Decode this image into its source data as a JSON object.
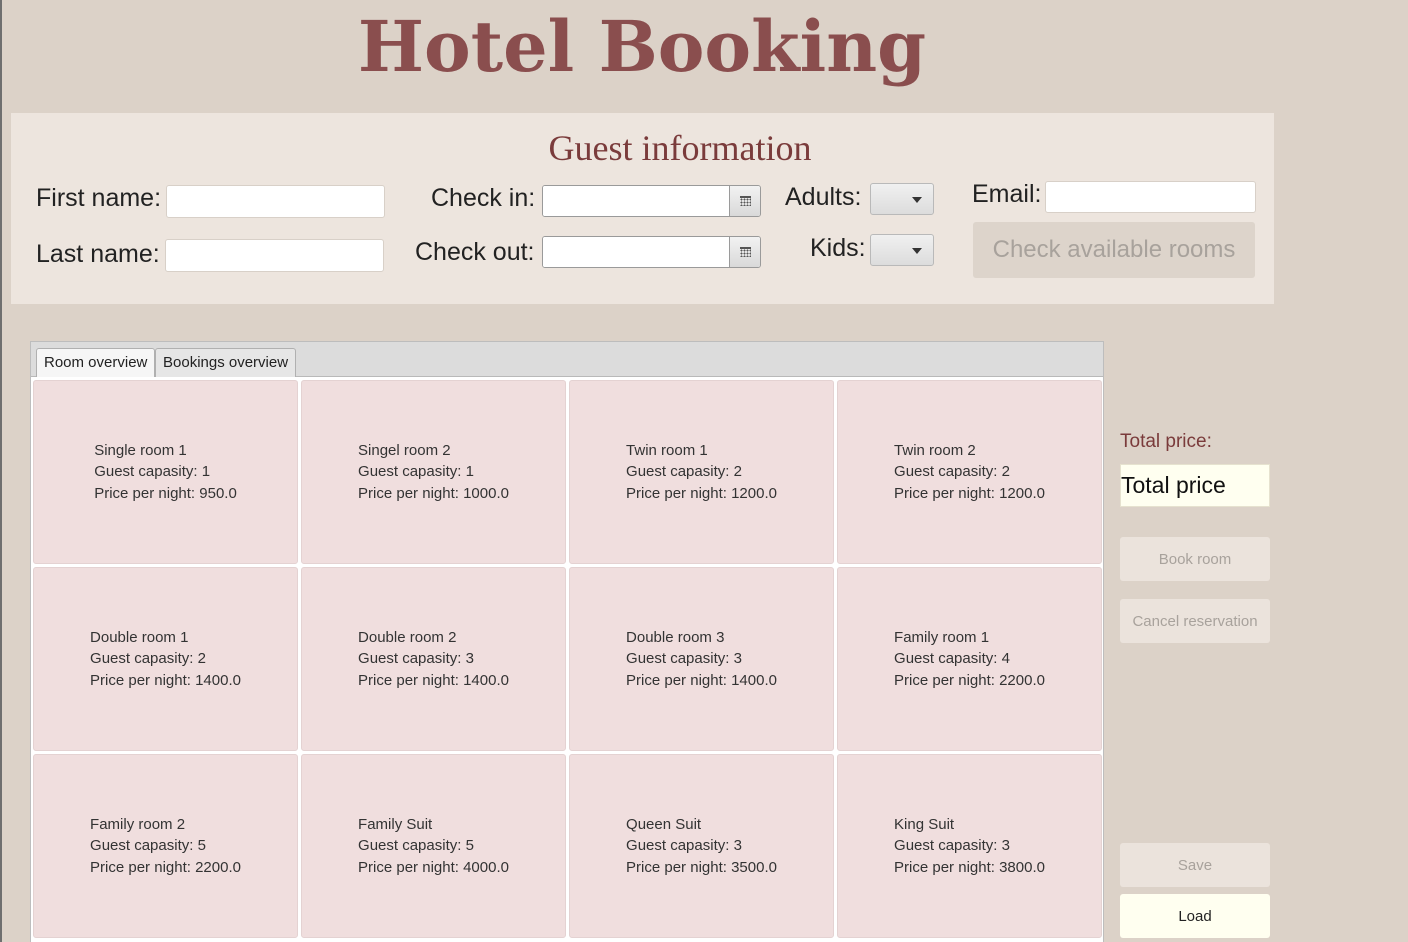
{
  "app": {
    "title": "Hotel Booking"
  },
  "guest": {
    "section_title": "Guest information",
    "first_name_label": "First name:",
    "first_name_value": "",
    "last_name_label": "Last name:",
    "last_name_value": "",
    "check_in_label": "Check in:",
    "check_in_value": "",
    "check_out_label": "Check out:",
    "check_out_value": "",
    "adults_label": "Adults:",
    "kids_label": "Kids:",
    "email_label": "Email:",
    "email_value": "",
    "check_button": "Check available rooms"
  },
  "tabs": [
    {
      "label": "Room overview",
      "active": true
    },
    {
      "label": "Bookings overview",
      "active": false
    }
  ],
  "rooms": [
    {
      "name": "Single room 1",
      "capacity": "Guest capasity: 1",
      "price": "Price per night: 950.0"
    },
    {
      "name": "Singel room 2",
      "capacity": "Guest capasity: 1",
      "price": "Price per night: 1000.0"
    },
    {
      "name": "Twin room 1",
      "capacity": "Guest capasity: 2",
      "price": "Price per night: 1200.0"
    },
    {
      "name": "Twin room 2",
      "capacity": "Guest capasity: 2",
      "price": "Price per night: 1200.0"
    },
    {
      "name": "Double room 1",
      "capacity": "Guest capasity: 2",
      "price": "Price per night: 1400.0"
    },
    {
      "name": "Double room 2",
      "capacity": "Guest capasity: 3",
      "price": "Price per night: 1400.0"
    },
    {
      "name": "Double room 3",
      "capacity": "Guest capasity: 3",
      "price": "Price per night: 1400.0"
    },
    {
      "name": "Family room 1",
      "capacity": "Guest capasity: 4",
      "price": "Price per night: 2200.0"
    },
    {
      "name": "Family room 2",
      "capacity": "Guest capasity: 5",
      "price": "Price per night: 2200.0"
    },
    {
      "name": "Family Suit",
      "capacity": "Guest capasity: 5",
      "price": "Price per night: 4000.0"
    },
    {
      "name": "Queen Suit",
      "capacity": "Guest capasity: 3",
      "price": "Price per night: 3500.0"
    },
    {
      "name": "King Suit",
      "capacity": "Guest capasity: 3",
      "price": "Price per night: 3800.0"
    }
  ],
  "sidebar": {
    "total_label": "Total price:",
    "total_value": "Total price",
    "book_button": "Book room",
    "cancel_button": "Cancel reservation",
    "save_button": "Save",
    "load_button": "Load"
  },
  "colors": {
    "background": "#dcd2c8",
    "title": "#8a4e4e",
    "panel": "#ede5de",
    "room_card": "#f0dede",
    "price_field": "#fffff0"
  }
}
